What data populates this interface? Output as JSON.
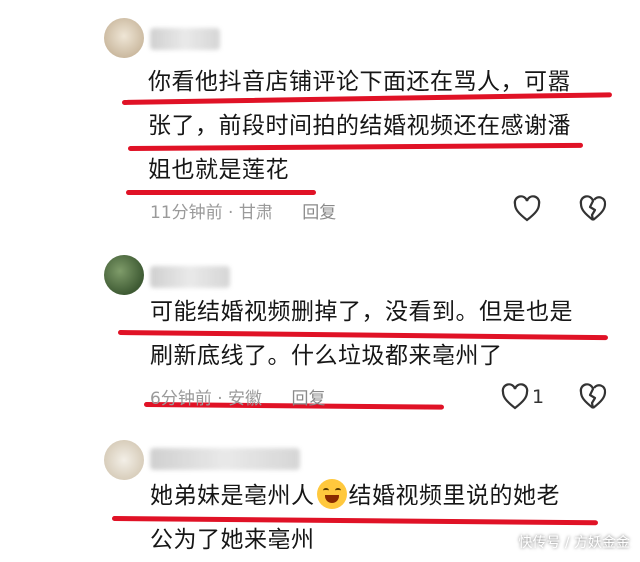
{
  "colors": {
    "underline": "#e01226",
    "meta": "#9a9a9a"
  },
  "comments": [
    {
      "lines": [
        "你看他抖音店铺评论下面还在骂人，可嚣",
        "张了，前段时间拍的结婚视频还在感谢潘",
        "姐也就是莲花"
      ],
      "time": "11分钟前",
      "location": "甘肃",
      "reply": "回复",
      "like_count": "",
      "icons": [
        "heart-icon",
        "broken-heart-icon"
      ]
    },
    {
      "lines": [
        "可能结婚视频删掉了，没看到。但是也是",
        "刷新底线了。什么垃圾都来亳州了"
      ],
      "time": "6分钟前",
      "location": "安徽",
      "reply": "回复",
      "like_count": "1",
      "icons": [
        "heart-icon",
        "broken-heart-icon"
      ]
    },
    {
      "line1_before": "她弟妹是亳州人",
      "line1_after": "结婚视频里说的她老",
      "line2": "公为了她来亳州",
      "emoji": "laughing-emoji-icon"
    }
  ],
  "watermark": "快传号 / 方妖金金"
}
